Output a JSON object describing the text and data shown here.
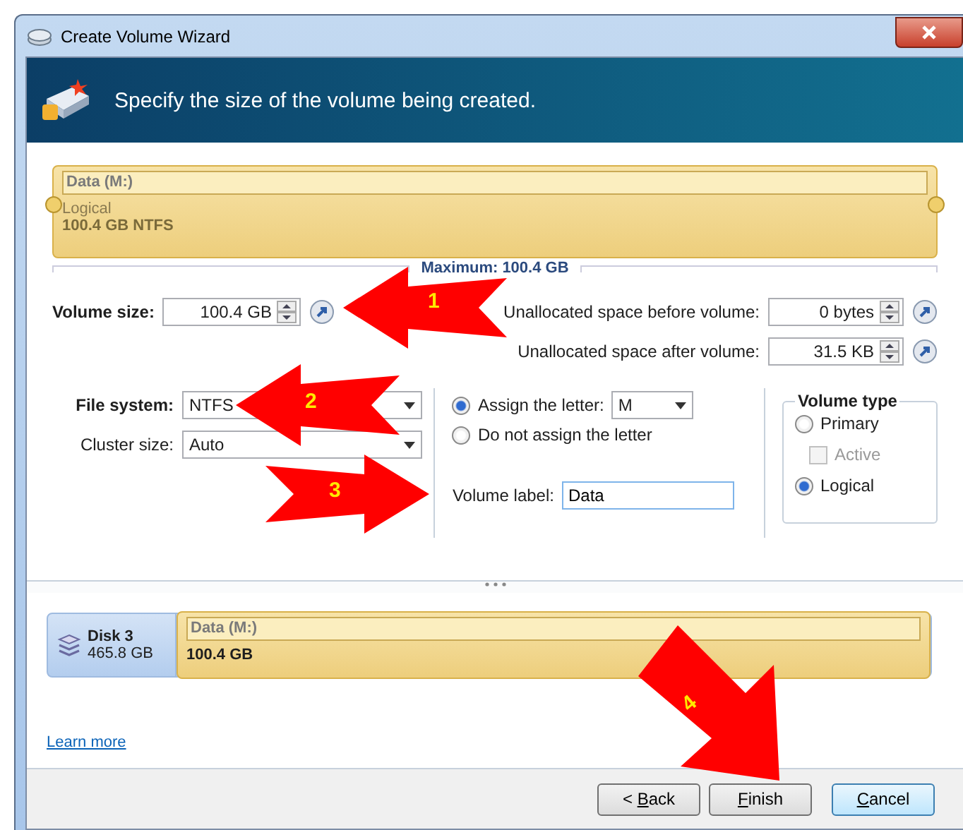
{
  "window": {
    "title": "Create Volume Wizard"
  },
  "header": {
    "text": "Specify the size of the volume being created."
  },
  "partition_bar": {
    "name": "Data (M:)",
    "type": "Logical",
    "size": "100.4 GB NTFS",
    "maximum": "Maximum: 100.4 GB"
  },
  "size_fields": [
    {
      "label": "Volume size:",
      "value": "100.4 GB",
      "bold": true
    },
    {
      "label": "Unallocated space before volume:",
      "value": "0 bytes",
      "bold": false
    },
    {
      "label": "Unallocated space after volume:",
      "value": "31.5 KB",
      "bold": false
    }
  ],
  "file_system": {
    "label": "File system:",
    "value": "NTFS"
  },
  "cluster_size": {
    "label": "Cluster size:",
    "value": "Auto"
  },
  "letter_options": [
    {
      "label": "Assign the letter:",
      "selected": true,
      "letter": "M"
    },
    {
      "label": "Do not assign the letter",
      "selected": false
    }
  ],
  "volume_label": {
    "label": "Volume label:",
    "value": "Data"
  },
  "volume_type": {
    "title": "Volume type",
    "options": [
      {
        "kind": "radio",
        "label": "Primary",
        "selected": false
      },
      {
        "kind": "checkbox",
        "label": "Active",
        "checked": false,
        "disabled": true
      },
      {
        "kind": "radio",
        "label": "Logical",
        "selected": true
      }
    ]
  },
  "disk": {
    "name": "Disk 3",
    "size": "465.8 GB",
    "partition": {
      "name": "Data (M:)",
      "size": "100.4 GB"
    }
  },
  "learn_more": "Learn more",
  "buttons": [
    {
      "label": "< Back",
      "primary": false
    },
    {
      "label": "Finish",
      "primary": false
    },
    {
      "label": "Cancel",
      "primary": true
    }
  ],
  "annotations": [
    {
      "label": "1"
    },
    {
      "label": "2"
    },
    {
      "label": "3"
    },
    {
      "label": "4"
    }
  ]
}
